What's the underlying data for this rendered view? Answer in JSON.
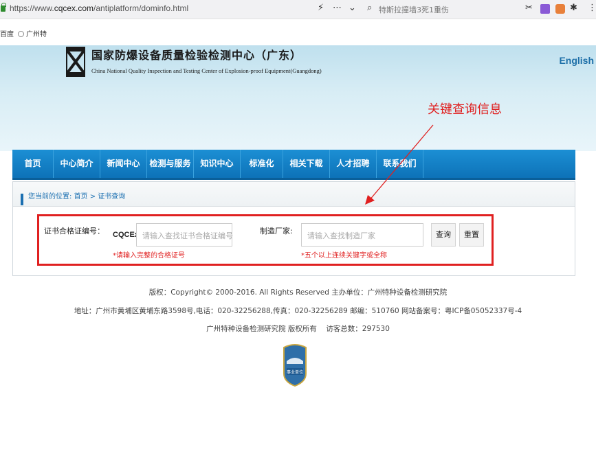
{
  "browser": {
    "url_prefix": "https://www.",
    "url_domain": "cqcex.com",
    "url_path": "/antiplatform/dominfo.html",
    "search_text": "特斯拉撞墙3死1重伤",
    "bookmarks": [
      "百度",
      "广州特​"
    ]
  },
  "header": {
    "english_link": "English",
    "title_cn": "国家防爆设备质量检验检测中心（广东）",
    "title_en": "China National Quality Inspection and Testing Center of Explosion-proof Equipment(Guangdong)"
  },
  "annotation": {
    "text": "关键查询信息",
    "color": "#e02020"
  },
  "nav": {
    "items": [
      "首页",
      "中心简介",
      "新闻中心",
      "检测与服务",
      "知识中心",
      "标准化",
      "相关下载",
      "人才招聘",
      "联系我们"
    ]
  },
  "breadcrumb": {
    "prefix": "您当前的位置:",
    "home": "首页",
    "sep": " > ",
    "current": "证书查询"
  },
  "query": {
    "cert_label": "证书合格证编号：",
    "cert_prefix": "CQCEx",
    "cert_placeholder": "请输入查找证书合格证编号",
    "cert_hint": "*请输入完整的合格证号",
    "maker_label": "制造厂家:",
    "maker_placeholder": "请输入查找制造厂家",
    "maker_hint": "*五个以上连续关键字或全称",
    "search_button": "查询",
    "reset_button": "重置"
  },
  "footer": {
    "line1": "版权：Copyright© 2000-2016. All Rights Reserved 主办单位：广州特种设备检测研究院",
    "line2": "地址：广州市黄埔区黄埔东路3598号,电话：020-32256288,传真：020-32256289 邮编：510760 网站备案号：粤ICP备05052337号-4",
    "line3_org": "广州特种设备检测研究院 版权所有",
    "line3_visits": "访客总数：297530",
    "badge_text": "事业单位"
  },
  "colors": {
    "brand_blue": "#0d72b8",
    "alert_red": "#e02020"
  }
}
